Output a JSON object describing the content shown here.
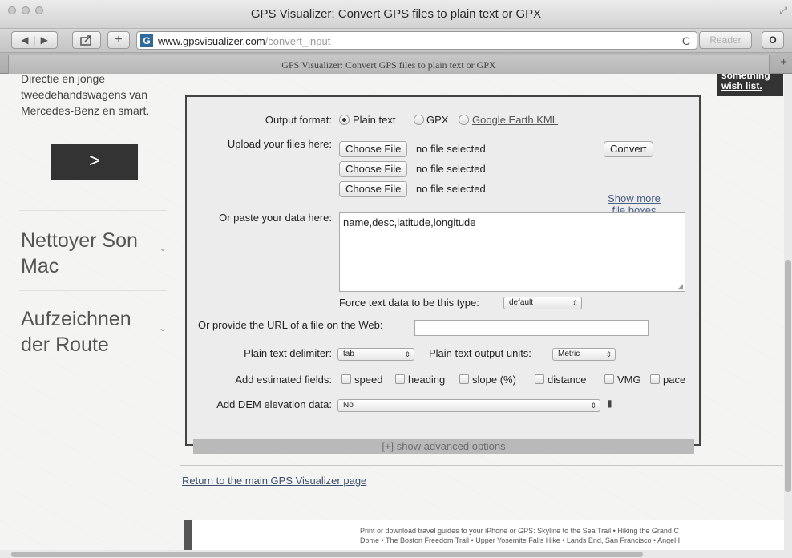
{
  "window": {
    "title": "GPS Visualizer: Convert GPS files to plain text or GPX",
    "tab_title": "GPS Visualizer: Convert GPS files to plain text or GPX"
  },
  "toolbar": {
    "back_icon": "back-arrow-icon",
    "forward_icon": "forward-arrow-icon",
    "share_icon": "share-icon",
    "add_icon": "+",
    "url_host": "www.gpsvisualizer.com",
    "url_path": "/convert_input",
    "reload_icon": "C",
    "reader_label": "Reader",
    "extension_label": "O"
  },
  "left_ad": {
    "text": "Directie en jonge tweedehandswagens van Mercedes-Benz en smart.",
    "cta": ">",
    "links": [
      "Nettoyer Son Mac",
      "Aufzeichnen der Route"
    ]
  },
  "wishlist": {
    "line1": "something",
    "line2": "wish list."
  },
  "form": {
    "output_format_label": "Output format:",
    "output_options": [
      "Plain text",
      "GPX",
      "Google Earth KML"
    ],
    "upload_label": "Upload your files here:",
    "file_rows": [
      {
        "button": "Choose File",
        "status": "no file selected"
      },
      {
        "button": "Choose File",
        "status": "no file selected"
      },
      {
        "button": "Choose File",
        "status": "no file selected"
      }
    ],
    "convert_label": "Convert",
    "show_more_line1": "Show more",
    "show_more_line2": "file boxes",
    "paste_label": "Or paste your data here:",
    "paste_value": "name,desc,latitude,longitude",
    "force_type_label": "Force text data to be this type:",
    "force_type_value": "default",
    "url_label": "Or provide the URL of a file on the Web:",
    "url_value": "",
    "delimiter_label": "Plain text delimiter:",
    "delimiter_value": "tab",
    "units_label": "Plain text output units:",
    "units_value": "Metric",
    "estimated_label": "Add estimated fields:",
    "estimated_fields": [
      "speed",
      "heading",
      "slope (%)",
      "distance",
      "VMG",
      "pace"
    ],
    "dem_label": "Add DEM elevation data:",
    "dem_value": "No",
    "advanced_label": "[+] show advanced options"
  },
  "footer": {
    "return_link": "Return to the main GPS Visualizer page",
    "bottom_ad_line1": "Print or download travel guides to your iPhone or GPS: Skyline to the Sea Trail • Hiking the Grand C",
    "bottom_ad_line2": "Dome • The Boston Freedom Trail • Upper Yosemite Falls Hike • Lands End, San Francisco • Angel I"
  }
}
